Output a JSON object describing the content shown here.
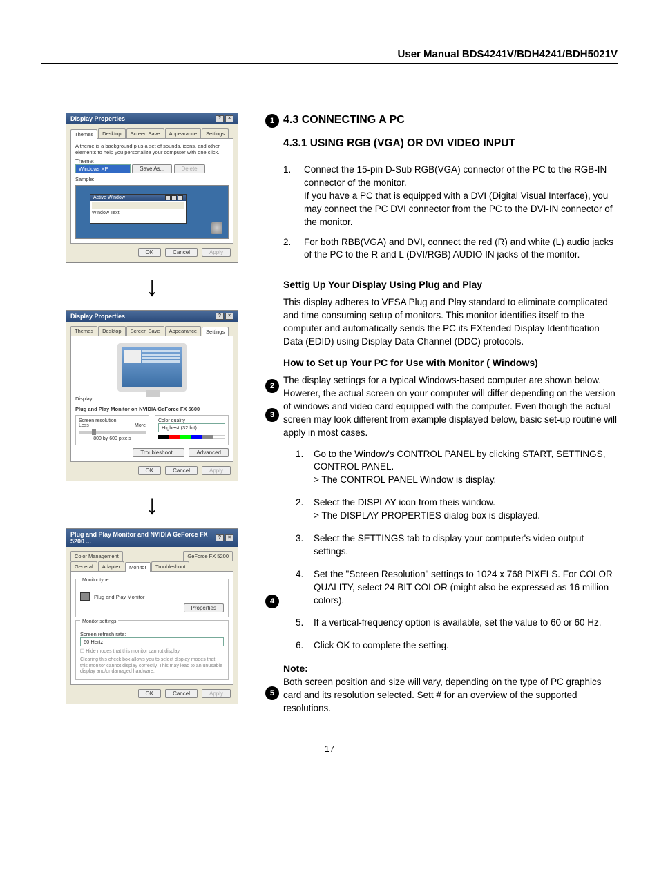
{
  "header": {
    "title": "User Manual BDS4241V/BDH4241/BDH5021V"
  },
  "section": "4.3   CONNECTING A PC",
  "subsection": "4.3.1  USING RGB (VGA) OR DVI VIDEO INPUT",
  "connect_steps": [
    {
      "num": "1.",
      "text": "Connect the 15-pin D-Sub RGB(VGA) connector of the PC to the RGB-IN connector of the monitor.",
      "extra": "If you have a PC that is equipped with a DVI (Digital Visual Interface), you may connect the PC DVI connector from the PC to the DVI-IN connector of the monitor."
    },
    {
      "num": "2.",
      "text": "For both RBB(VGA) and DVI, connect the red (R) and white (L) audio jacks of the PC to the R and L (DVI/RGB) AUDIO IN jacks of the monitor."
    }
  ],
  "pnp_heading": "Settig Up Your Display Using Plug and Play",
  "pnp_para": "This display adheres to VESA Plug and Play standard to eliminate complicated and time consuming setup of monitors.  This monitor identifies itself to the computer and automatically sends the PC its EXtended Display Identification Data (EDID) using Display Data Channel (DDC) protocols.",
  "howto_heading": "How to Set up Your PC for Use with Monitor ( Windows)",
  "howto_intro": "The display settings for a typical Windows-based computer are shown below. Howerer, the actual screen on your computer will differ depending on the version of windows and video card equipped with the computer. Even though the actual screen may look different from example displayed below, basic set-up routine will apply in most cases.",
  "howto_steps": [
    {
      "num": "1.",
      "text": "Go to the Window's CONTROL PANEL by clicking START, SETTINGS, CONTROL PANEL.",
      "sub": "> The CONTROL PANEL Window is display."
    },
    {
      "num": "2.",
      "text": "Select the DISPLAY icon from theis window.",
      "sub": "> The DISPLAY PROPERTIES dialog box is displayed."
    },
    {
      "num": "3.",
      "text": "Select the SETTINGS tab to display your computer's video output settings."
    },
    {
      "num": "4.",
      "text": "Set the \"Screen Resolution\" settings to 1024 x 768 PIXELS.  For COLOR QUALITY, select 24 BIT COLOR (might also be expressed as 16 million colors)."
    },
    {
      "num": "5.",
      "text": "If a vertical-frequency option is available, set the value to 60 or 60 Hz."
    },
    {
      "num": "6.",
      "text": "Click OK to complete the setting."
    }
  ],
  "note_label": "Note:",
  "note_text": "Both screen position and size will vary, depending on the type of PC graphics card and its resolution selected.  Sett # for an overview of the supported resolutions.",
  "page_number": "17",
  "dialog1": {
    "title": "Display Properties",
    "tabs": [
      "Themes",
      "Desktop",
      "Screen Save",
      "Appearance",
      "Settings"
    ],
    "active_tab": "Themes",
    "desc": "A theme is a background plus a set of sounds, icons, and other elements to help you personalize your computer with one click.",
    "theme_label": "Theme:",
    "theme_value": "Windows XP",
    "save_as": "Save As...",
    "delete": "Delete",
    "sample_label": "Sample:",
    "active_window": "Active Window",
    "window_text": "Window Text",
    "ok": "OK",
    "cancel": "Cancel",
    "apply": "Apply"
  },
  "dialog2": {
    "title": "Display Properties",
    "tabs": [
      "Themes",
      "Desktop",
      "Screen Save",
      "Appearance",
      "Settings"
    ],
    "active_tab": "Settings",
    "display_label": "Display:",
    "display_name": "Plug and Play Monitor on NVIDIA GeForce FX 5600",
    "res_label": "Screen resolution",
    "less": "Less",
    "more": "More",
    "res_value": "800 by 600 pixels",
    "color_label": "Color quality",
    "color_value": "Highest (32 bit)",
    "troubleshoot": "Troubleshoot...",
    "advanced": "Advanced",
    "ok": "OK",
    "cancel": "Cancel",
    "apply": "Apply"
  },
  "dialog3": {
    "title": "Plug and Play Monitor and NVIDIA GeForce FX 5200 ...",
    "tabs_top": [
      "Color Management",
      "GeForce FX 5200"
    ],
    "tabs_bottom": [
      "General",
      "Adapter",
      "Monitor",
      "Troubleshoot"
    ],
    "active_tab": "Monitor",
    "mtype_label": "Monitor type",
    "mtype_value": "Plug and Play Monitor",
    "properties": "Properties",
    "msettings_label": "Monitor settings",
    "refresh_label": "Screen refresh rate:",
    "refresh_value": "60 Hertz",
    "hide_modes": "Hide modes that this monitor cannot display",
    "hide_note": "Clearing this check box allows you to select display modes that this monitor cannot display correctly. This may lead to an unusable display and/or damaged hardware.",
    "ok": "OK",
    "cancel": "Cancel",
    "apply": "Apply"
  },
  "callouts": {
    "c1": "1",
    "c2": "2",
    "c3": "3",
    "c4": "4",
    "c5": "5"
  }
}
